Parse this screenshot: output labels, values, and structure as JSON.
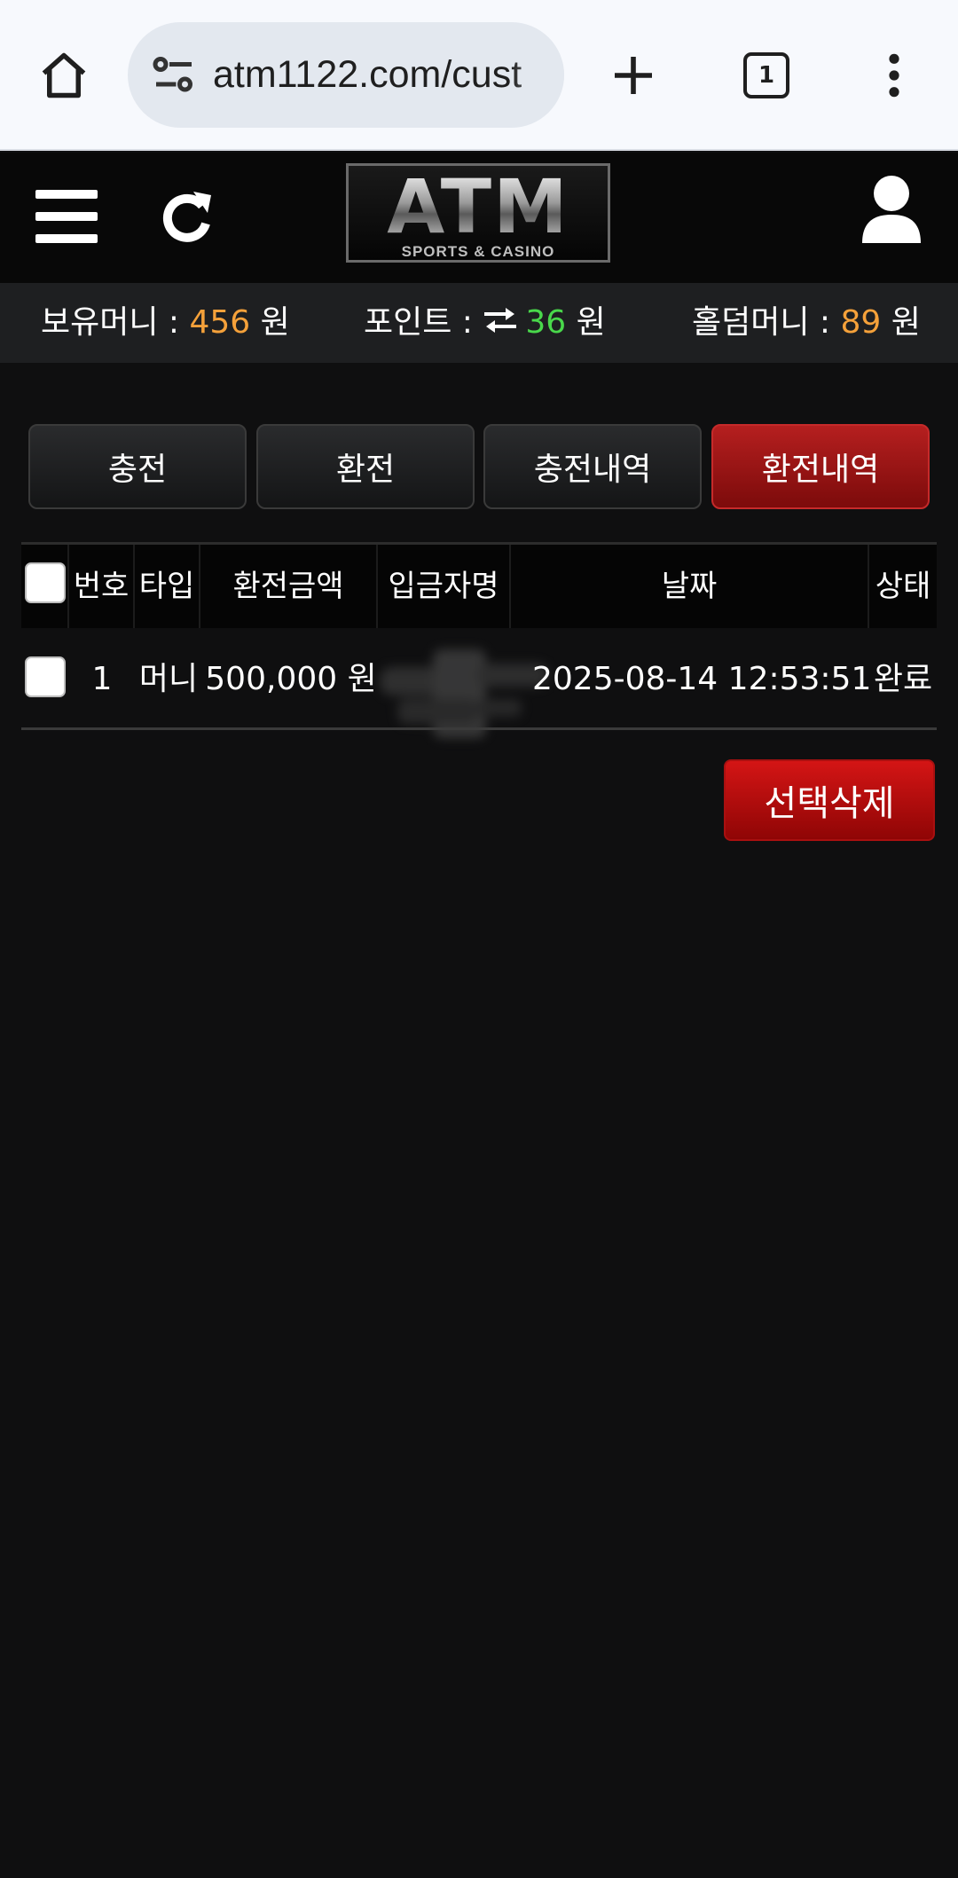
{
  "browser": {
    "url": "atm1122.com/cust",
    "tab_count": "1"
  },
  "header": {
    "logo_main": "ATM",
    "logo_sub": "SPORTS & CASINO"
  },
  "balance": {
    "money_label": "보유머니 : ",
    "money_value": "456",
    "money_unit": " 원",
    "point_label": "포인트 : ",
    "point_value": "36",
    "point_unit": " 원",
    "holdem_label": "홀덤머니 : ",
    "holdem_value": "89",
    "holdem_unit": " 원"
  },
  "tabs": [
    {
      "label": "충전",
      "active": false
    },
    {
      "label": "환전",
      "active": false
    },
    {
      "label": "충전내역",
      "active": false
    },
    {
      "label": "환전내역",
      "active": true
    }
  ],
  "table": {
    "headers": [
      "번호",
      "타입",
      "환전금액",
      "입금자명",
      "날짜",
      "상태"
    ],
    "rows": [
      {
        "no": "1",
        "type": "머니",
        "amount": "500,000 원",
        "depositor": "",
        "date": "2025-08-14 12:53:51",
        "status": "완료"
      }
    ]
  },
  "actions": {
    "delete_selected": "선택삭제"
  },
  "colors": {
    "accent_red": "#b51f1f",
    "money_orange": "#f5a13a",
    "point_green": "#49d84b"
  }
}
